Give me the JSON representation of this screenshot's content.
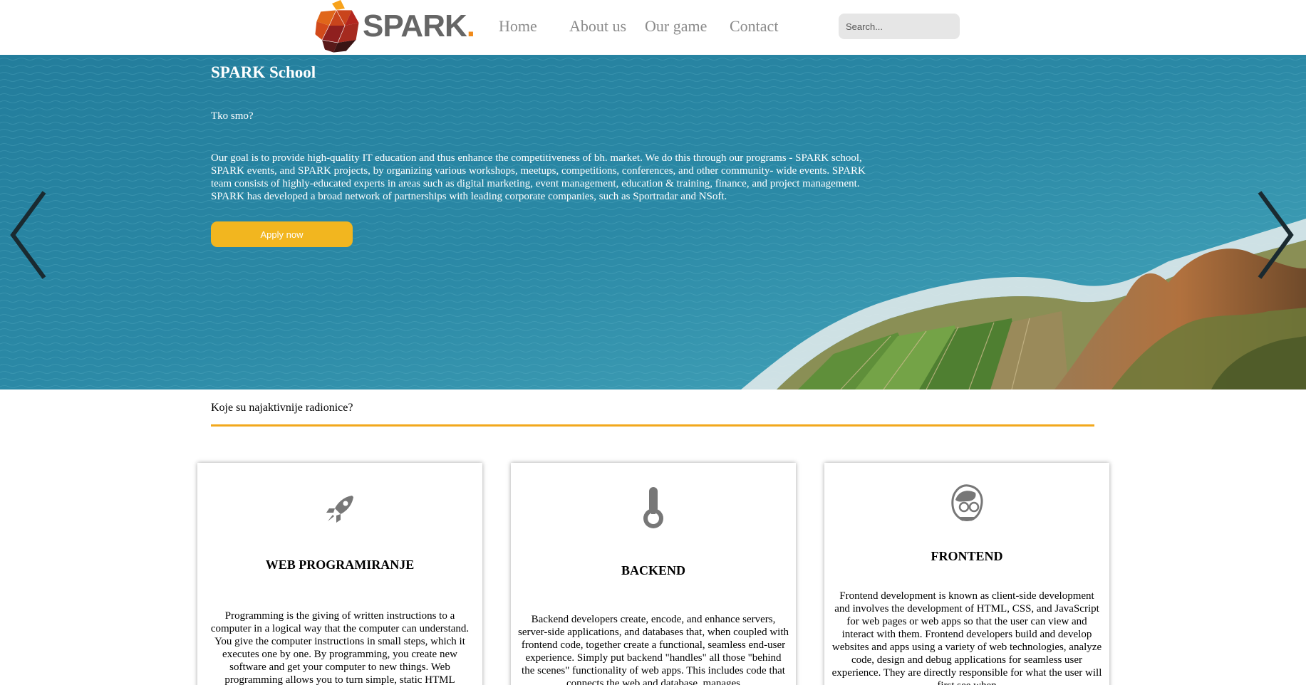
{
  "header": {
    "logo_text": "SPARK",
    "logo_dot": ".",
    "nav": [
      "Home",
      "About us",
      "Our game",
      "Contact"
    ],
    "search_placeholder": "Search..."
  },
  "hero": {
    "title": "SPARK School",
    "subtitle": "Tko smo?",
    "text": "Our goal is to provide high-quality IT education and thus enhance the competitiveness of bh. market. We do this through our programs - SPARK school, SPARK events, and SPARK projects, by organizing various workshops, meetups, competitions, conferences, and other community- wide events. SPARK team consists of highly-educated experts in areas such as digital marketing, event management, education & training, finance, and project management. SPARK has developed a broad network of partnerships with leading corporate companies, such as Sportradar and NSoft.",
    "button": "Apply now"
  },
  "section": {
    "question": "Koje su najaktivnije radionice?"
  },
  "cards": [
    {
      "icon": "rocket-icon",
      "title": "WEB PROGRAMIRANJE",
      "text": "Programming is the giving of written instructions to a computer in a logical way that the computer can understand. You give the computer instructions in small steps, which it executes one by one. By programming, you create new software and get your computer to new things. Web programming allows you to turn simple, static HTML"
    },
    {
      "icon": "thermometer-icon",
      "title": "BACKEND",
      "text": "Backend developers create, encode, and enhance servers, server-side applications, and databases that, when coupled with frontend code, together create a functional, seamless end-user experience. Simply put backend \"handles\" all those \"behind the scenes\" functionality of web apps. This includes code that connects the web and database, manages"
    },
    {
      "icon": "developer-avatar-icon",
      "title": "FRONTEND",
      "text": "Frontend development is known as client-side development and involves the development of HTML, CSS, and JavaScript for web pages or web apps so that the user can view and interact with them. Frontend developers build and develop websites and apps using a variety of web technologies, analyze code, design and debug applications for seamless user experience. They are directly responsible for what the user will first see when"
    }
  ],
  "colors": {
    "accent": "#f2a81d",
    "button": "#f2b61f",
    "nav_text": "#8a8a8a",
    "sea": "#2a86a4"
  }
}
